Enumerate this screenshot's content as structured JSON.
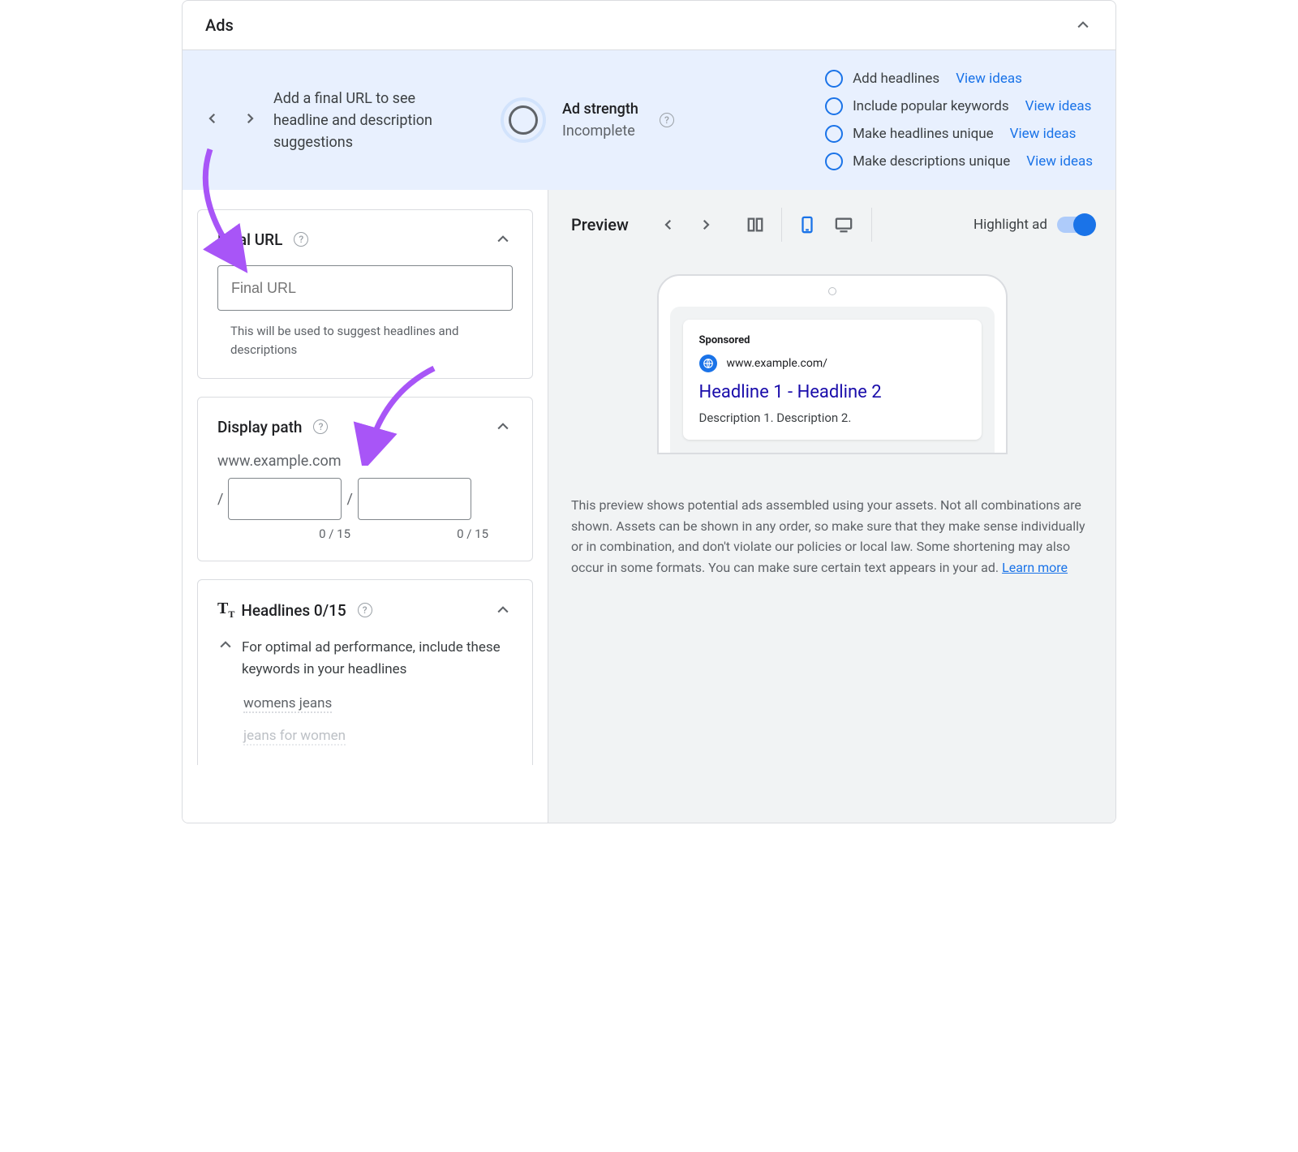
{
  "header": {
    "title": "Ads"
  },
  "banner": {
    "hint": "Add a final URL to see headline and description suggestions",
    "strength_label": "Ad strength",
    "strength_status": "Incomplete",
    "checklist": [
      {
        "label": "Add headlines",
        "link": "View ideas"
      },
      {
        "label": "Include popular keywords",
        "link": "View ideas"
      },
      {
        "label": "Make headlines unique",
        "link": "View ideas"
      },
      {
        "label": "Make descriptions unique",
        "link": "View ideas"
      }
    ]
  },
  "final_url": {
    "title": "Final URL",
    "placeholder": "Final URL",
    "helper": "This will be used to suggest headlines and descriptions"
  },
  "display_path": {
    "title": "Display path",
    "domain": "www.example.com",
    "counter1": "0 / 15",
    "counter2": "0 / 15"
  },
  "headlines": {
    "title": "Headlines 0/15",
    "hint": "For optimal ad performance, include these keywords in your headlines",
    "keywords": [
      "womens jeans",
      "jeans for women"
    ]
  },
  "preview": {
    "title": "Preview",
    "highlight_label": "Highlight ad",
    "ad": {
      "sponsored": "Sponsored",
      "url": "www.example.com/",
      "headline": "Headline 1 - Headline 2",
      "description": "Description 1. Description 2."
    },
    "note": "This preview shows potential ads assembled using your assets. Not all combinations are shown. Assets can be shown in any order, so make sure that they make sense individually or in combination, and don't violate our policies or local law. Some shortening may also occur in some formats. You can make sure certain text appears in your ad. ",
    "learn_more": "Learn more"
  },
  "colors": {
    "accent": "#1a73e8",
    "annotation": "#a855f7"
  }
}
